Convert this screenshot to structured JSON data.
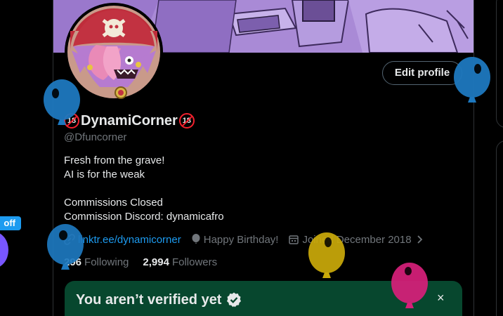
{
  "profile": {
    "badge_left": "18",
    "display_name": "DynamiCorner",
    "badge_right": "18",
    "handle": "@Dfuncorner",
    "bio_lines": [
      "Fresh from the grave!",
      "AI is for the weak",
      "",
      "Commissions Closed",
      "Commission Discord: dynamicafro"
    ],
    "link": "linktr.ee/dynamicorner",
    "birthday": "Happy Birthday!",
    "joined": "Joined December 2018",
    "following_count": "296",
    "following_label": "Following",
    "followers_count": "2,994",
    "followers_label": "Followers"
  },
  "actions": {
    "edit_profile": "Edit profile"
  },
  "verify_card": {
    "title": "You aren’t verified yet",
    "close": "×"
  },
  "left_panel": {
    "pill_text": "off"
  },
  "balloons": [
    {
      "color": "#1d78bf"
    },
    {
      "color": "#1d78bf"
    },
    {
      "color": "#1d78bf"
    },
    {
      "color": "#c9a90a"
    },
    {
      "color": "#d61f7a"
    }
  ],
  "colors": {
    "accent": "#1d9bf0",
    "verify_bg": "#07472e",
    "banner": "#b08fdc",
    "badge_red": "#f4212e"
  }
}
